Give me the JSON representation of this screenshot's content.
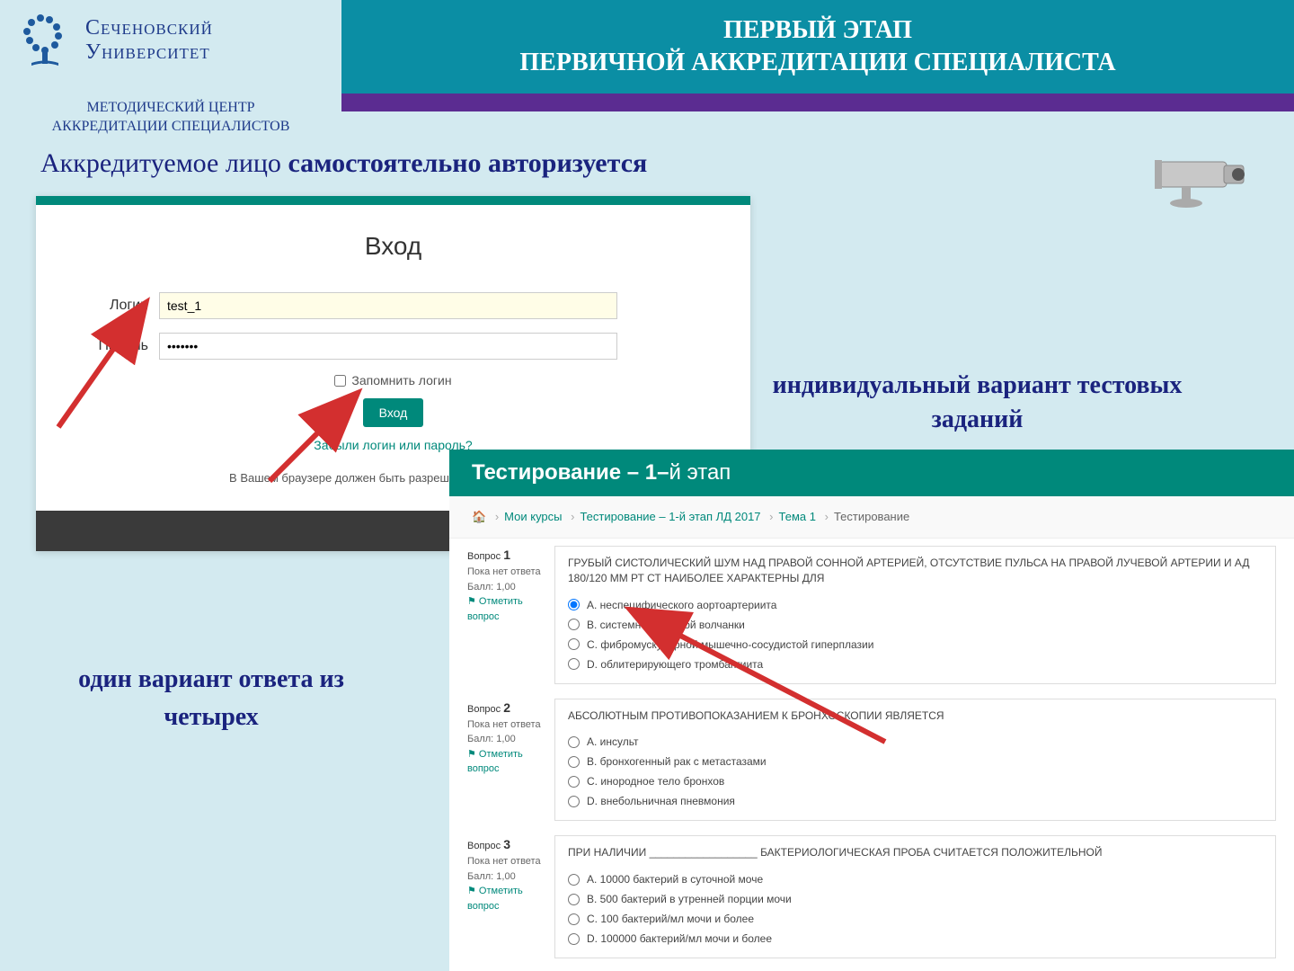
{
  "header": {
    "university_line1": "Сеченовский",
    "university_line2": "Университет",
    "subheader_line1": "МЕТОДИЧЕСКИЙ ЦЕНТР",
    "subheader_line2": "АККРЕДИТАЦИИ СПЕЦИАЛИСТОВ",
    "title_line1": "ПЕРВЫЙ ЭТАП",
    "title_line2": "ПЕРВИЧНОЙ АККРЕДИТАЦИИ СПЕЦИАЛИСТА"
  },
  "slide_title_prefix": "Аккредитуемое лицо ",
  "slide_title_bold": "самостоятельно авторизуется",
  "callout_individual": "индивидуальный вариант тестовых заданий",
  "callout_one_of_four": "один вариант ответа из четырех",
  "login": {
    "heading": "Вход",
    "login_label": "Логин",
    "password_label": "Пароль",
    "login_value": "test_1",
    "password_value": "•••••••",
    "remember": "Запомнить логин",
    "button": "Вход",
    "forgot": "Забыли логин или пароль?",
    "cookie_note": "В Вашем браузере должен быть разрешен прием cookies ⓘ"
  },
  "test": {
    "header_bold": "Тестирование – 1–",
    "header_thin": "й этап",
    "breadcrumb": {
      "home": "🏠",
      "c1": "Мои курсы",
      "c2": "Тестирование – 1-й этап ЛД 2017",
      "c3": "Тема 1",
      "c4": "Тестирование"
    },
    "questions": [
      {
        "num": "1",
        "status": "Пока нет ответа",
        "score": "Балл: 1,00",
        "flag": "⚑ Отметить вопрос",
        "text": "ГРУБЫЙ СИСТОЛИЧЕСКИЙ ШУМ НАД ПРАВОЙ СОННОЙ АРТЕРИЕЙ, ОТСУТСТВИЕ ПУЛЬСА НА ПРАВОЙ ЛУЧЕВОЙ АРТЕРИИ И АД 180/120 ММ РТ СТ НАИБОЛЕЕ ХАРАКТЕРНЫ ДЛЯ",
        "options": [
          "A. неспецифического аортоартериита",
          "B. системной красной волчанки",
          "C. фибромускулярной мышечно-сосудистой гиперплазии",
          "D. облитерирующего тромбангиита"
        ]
      },
      {
        "num": "2",
        "status": "Пока нет ответа",
        "score": "Балл: 1,00",
        "flag": "⚑ Отметить вопрос",
        "text": "АБСОЛЮТНЫМ ПРОТИВОПОКАЗАНИЕМ К БРОНХОСКОПИИ ЯВЛЯЕТСЯ",
        "options": [
          "A. инсульт",
          "B. бронхогенный рак с метастазами",
          "C. инородное тело бронхов",
          "D. внебольничная пневмония"
        ]
      },
      {
        "num": "3",
        "status": "Пока нет ответа",
        "score": "Балл: 1,00",
        "flag": "⚑ Отметить вопрос",
        "text": "ПРИ НАЛИЧИИ __________________ БАКТЕРИОЛОГИЧЕСКАЯ ПРОБА СЧИТАЕТСЯ ПОЛОЖИТЕЛЬНОЙ",
        "options": [
          "A. 10000 бактерий в суточной моче",
          "B. 500 бактерий в утренней порции мочи",
          "C. 100 бактерий/мл мочи и более",
          "D. 100000 бактерий/мл мочи и более"
        ]
      }
    ]
  }
}
